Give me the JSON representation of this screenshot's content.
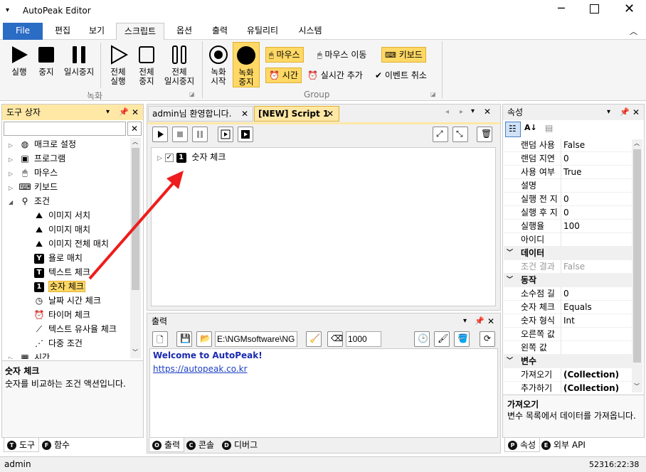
{
  "window": {
    "title": "AutoPeak Editor"
  },
  "menu": {
    "file": "File",
    "tabs": [
      "편집",
      "보기",
      "스크립트",
      "옵션",
      "출력",
      "유틸리티",
      "시스템"
    ]
  },
  "ribbon": {
    "run": "실행",
    "stop": "중지",
    "pause": "일시중지",
    "all_run": [
      "전체",
      "실행"
    ],
    "all_stop": [
      "전체",
      "중지"
    ],
    "all_pause": [
      "전체",
      "일시중지"
    ],
    "rec_start": [
      "녹화",
      "시작"
    ],
    "rec_stop": [
      "녹화",
      "중지"
    ],
    "record_group": "녹화",
    "mouse": "마우스",
    "mouse_move": "마우스 이동",
    "keyboard": "키보드",
    "time": "시간",
    "realtime_add": "실시간 추가",
    "event_cancel": "이벤트 취소",
    "group_label": "Group"
  },
  "toolbox": {
    "title": "도구 상자",
    "search_placeholder": "",
    "items": [
      {
        "label": "매크로 설정",
        "icon": "globe-icon",
        "indent": 0,
        "expander": "▷"
      },
      {
        "label": "프로그램",
        "icon": "window-icon",
        "indent": 0,
        "expander": "▷"
      },
      {
        "label": "마우스",
        "icon": "mouse-icon",
        "indent": 0,
        "expander": "▷"
      },
      {
        "label": "키보드",
        "icon": "keyboard-icon",
        "indent": 0,
        "expander": "▷"
      },
      {
        "label": "조건",
        "icon": "condition-icon",
        "indent": 0,
        "expander": "◢"
      },
      {
        "label": "이미지 서치",
        "icon": "image-search-icon",
        "indent": 1
      },
      {
        "label": "이미지 매치",
        "icon": "image-match-icon",
        "indent": 1
      },
      {
        "label": "이미지 전체 매치",
        "icon": "image-match-all-icon",
        "indent": 1
      },
      {
        "label": "욜로 매치",
        "icon": "yolo-icon",
        "indent": 1
      },
      {
        "label": "텍스트 체크",
        "icon": "text-check-icon",
        "indent": 1
      },
      {
        "label": "숫자 체크",
        "icon": "number-check-icon",
        "indent": 1,
        "selected": true
      },
      {
        "label": "날짜 시간 체크",
        "icon": "clock-icon",
        "indent": 1
      },
      {
        "label": "타이머 체크",
        "icon": "alarm-icon",
        "indent": 1
      },
      {
        "label": "텍스트 유사율 체크",
        "icon": "similarity-icon",
        "indent": 1
      },
      {
        "label": "다중 조건",
        "icon": "multi-condition-icon",
        "indent": 1
      },
      {
        "label": "시간",
        "icon": "calendar-icon",
        "indent": 0,
        "expander": "▷"
      }
    ],
    "desc_title": "숫자 체크",
    "desc_text": "숫자를 비교하는 조건 액션입니다.",
    "tabs": [
      {
        "badge": "T",
        "label": "도구"
      },
      {
        "badge": "F",
        "label": "함수"
      }
    ]
  },
  "doc_tabs": [
    {
      "label": "admin님 환영합니다.",
      "active": false
    },
    {
      "label": "[NEW] Script 1",
      "active": true
    }
  ],
  "script": {
    "node_number": "1",
    "node_label": "숫자 체크"
  },
  "output": {
    "title": "출력",
    "path": "E:\\NGMsoftware\\NG",
    "count": "1000",
    "welcome": "Welcome to AutoPeak!",
    "link": "https://autopeak.co.kr",
    "tabs": [
      {
        "badge": "O",
        "label": "출력"
      },
      {
        "badge": "C",
        "label": "콘솔"
      },
      {
        "badge": "D",
        "label": "디버그"
      }
    ]
  },
  "properties": {
    "title": "속성",
    "rows": [
      {
        "type": "prop",
        "name": "랜덤 사용",
        "value": "False"
      },
      {
        "type": "prop",
        "name": "랜덤 지연",
        "value": "0"
      },
      {
        "type": "prop",
        "name": "사용 여부",
        "value": "True"
      },
      {
        "type": "prop",
        "name": "설명",
        "value": ""
      },
      {
        "type": "prop",
        "name": "실행 전 지",
        "value": "0"
      },
      {
        "type": "prop",
        "name": "실행 후 지",
        "value": "0"
      },
      {
        "type": "prop",
        "name": "실행율",
        "value": "100"
      },
      {
        "type": "prop",
        "name": "아이디",
        "value": ""
      },
      {
        "type": "cat",
        "name": "데이터"
      },
      {
        "type": "prop",
        "name": "조건 결과",
        "value": "False",
        "disabled": true
      },
      {
        "type": "cat",
        "name": "동작"
      },
      {
        "type": "prop",
        "name": "소수점 길",
        "value": "0"
      },
      {
        "type": "prop",
        "name": "숫자 체크",
        "value": "Equals"
      },
      {
        "type": "prop",
        "name": "숫자 형식",
        "value": "Int"
      },
      {
        "type": "prop",
        "name": "오른쪽 값",
        "value": ""
      },
      {
        "type": "prop",
        "name": "왼쪽 값",
        "value": ""
      },
      {
        "type": "cat",
        "name": "변수"
      },
      {
        "type": "prop",
        "name": "가져오기",
        "value": "(Collection)",
        "bold": true
      },
      {
        "type": "prop",
        "name": "추가하기",
        "value": "(Collection)",
        "bold": true
      }
    ],
    "desc_title": "가져오기",
    "desc_text": "변수 목록에서 데이터를 가져옵니다.",
    "tabs": [
      {
        "badge": "P",
        "label": "속성"
      },
      {
        "badge": "E",
        "label": "외부 API"
      }
    ]
  },
  "status": {
    "user": "admin",
    "time": "52316:22:38"
  },
  "colors": {
    "accent": "#2b579a",
    "file_tab": "#2b6cc4",
    "panel_head": "#ffe8a6",
    "selected": "#ffd865",
    "arrow": "#ee1c1c",
    "link": "#1a3fc4",
    "welcome": "#1a2bb0"
  }
}
